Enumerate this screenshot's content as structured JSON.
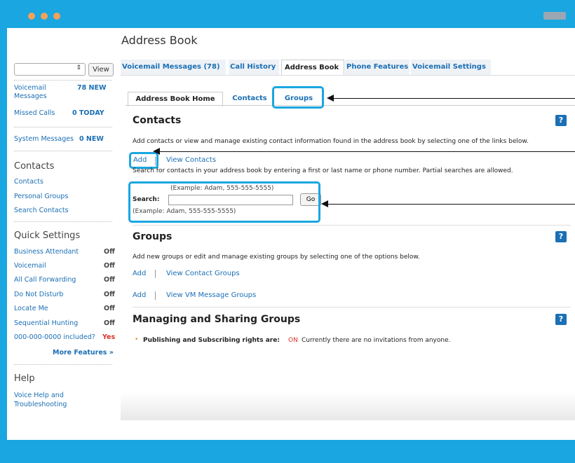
{
  "page_title": "Address Book",
  "sidebar": {
    "select_value": "",
    "view_button": "View",
    "stats": [
      {
        "label": "Voicemail Messages",
        "value": "78 NEW"
      },
      {
        "label": "Missed Calls",
        "value": "0 TODAY"
      },
      {
        "label": "System Messages",
        "value": "0 NEW"
      }
    ],
    "contacts_heading": "Contacts",
    "contacts_links": [
      "Contacts",
      "Personal Groups",
      "Search Contacts"
    ],
    "quick_heading": "Quick Settings",
    "quick_settings": [
      {
        "label": "Business Attendant",
        "value": "Off"
      },
      {
        "label": "Voicemail",
        "value": "Off"
      },
      {
        "label": "All Call Forwarding",
        "value": "Off"
      },
      {
        "label": "Do Not Disturb",
        "value": "Off"
      },
      {
        "label": "Locate Me",
        "value": "Off"
      },
      {
        "label": "Sequential Hunting",
        "value": "Off"
      },
      {
        "label": "000-000-0000 included?",
        "value": "Yes"
      }
    ],
    "more_features": "More Features »",
    "help_heading": "Help",
    "help_link": "Voice Help and Troubleshooting"
  },
  "tabs": [
    "Voicemail Messages (78)",
    "Call History",
    "Address Book",
    "Phone Features",
    "Voicemail Settings"
  ],
  "subtabs": [
    "Address Book Home",
    "Contacts",
    "Groups"
  ],
  "contacts": {
    "title": "Contacts",
    "help": "?",
    "desc": "Add contacts or view and manage existing contact information found in the address book by selecting one of the links below.",
    "add": "Add",
    "view_contacts": "View Contacts",
    "search_desc": "Search for contacts in your address book by entering a first or last name or phone number. Partial searches are allowed.",
    "example_top": "(Example: Adam, 555-555-5555)",
    "search_label": "Search:",
    "go": "Go",
    "example_bottom": "(Example: Adam, 555-555-5555)"
  },
  "groups": {
    "title": "Groups",
    "help": "?",
    "desc": "Add new groups or edit and manage existing groups by selecting one of the options below.",
    "add1": "Add",
    "view_contact_groups": "View Contact Groups",
    "add2": "Add",
    "view_vm_groups": "View VM Message Groups"
  },
  "managing": {
    "title": "Managing and Sharing Groups",
    "help": "?",
    "bullet_label": "Publishing and Subscribing rights are:",
    "status": "ON",
    "status_color": "#d9342b",
    "rest": "Currently there are no invitations from anyone."
  },
  "colors": {
    "accent": "#1aa6e0",
    "link": "#1b6fb5"
  }
}
